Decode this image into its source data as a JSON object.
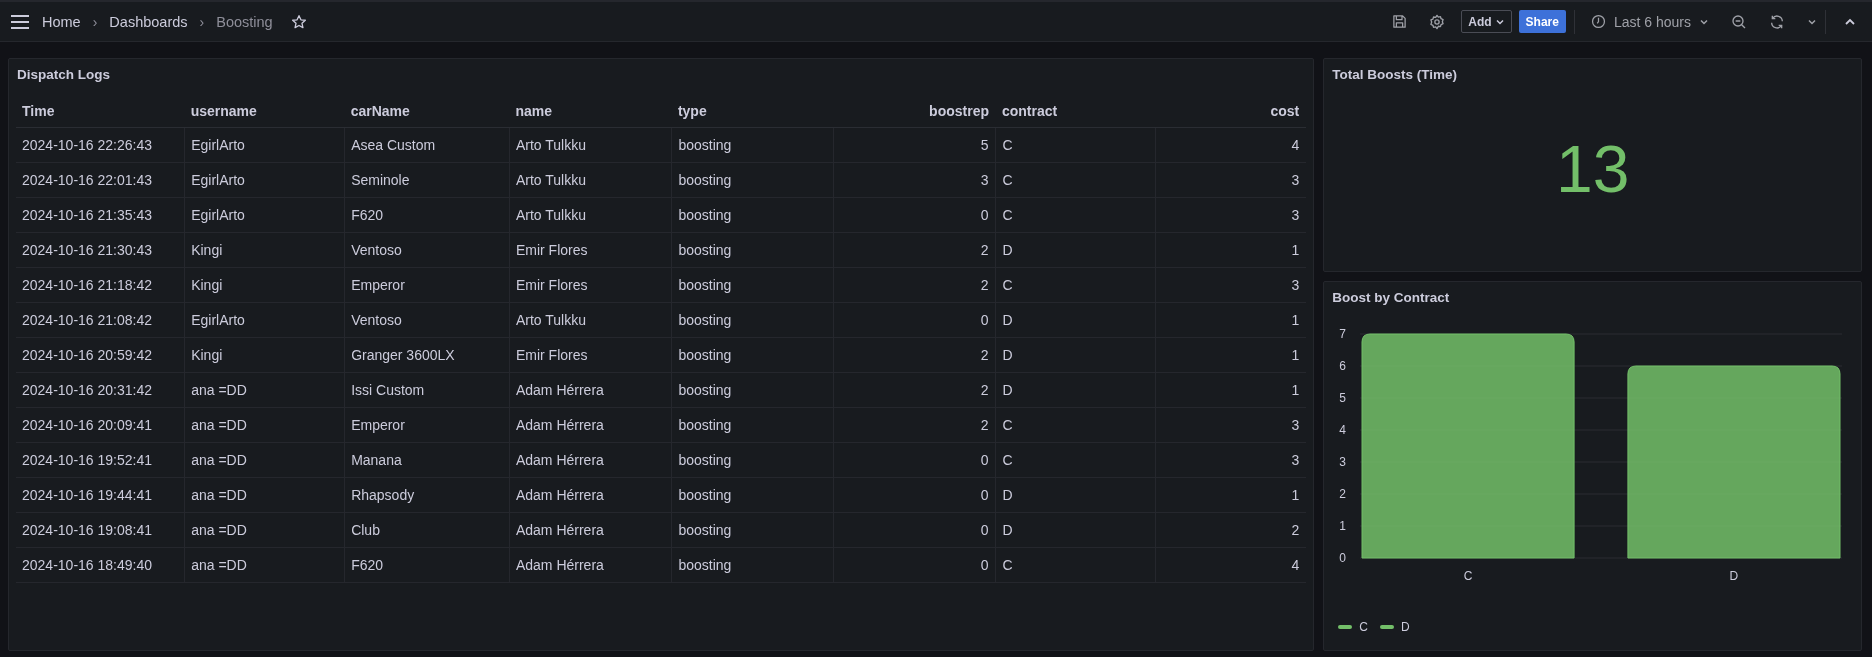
{
  "breadcrumbs": [
    {
      "label": "Home",
      "current": false
    },
    {
      "separator": "›",
      "label": "Dashboards",
      "current": false
    },
    {
      "separator": "›",
      "label": "Boosting",
      "current": true
    }
  ],
  "toolbar": {
    "add_label": "Add",
    "share_label": "Share",
    "time_range": "Last 6 hours"
  },
  "table_panel": {
    "title": "Dispatch Logs",
    "columns": [
      "Time",
      "username",
      "carName",
      "name",
      "type",
      "boostrep",
      "contract",
      "cost"
    ],
    "rows": [
      [
        "2024-10-16 22:26:43",
        "EgirlArto",
        "Asea Custom",
        "Arto Tulkku",
        "boosting",
        "5",
        "C",
        "4"
      ],
      [
        "2024-10-16 22:01:43",
        "EgirlArto",
        "Seminole",
        "Arto Tulkku",
        "boosting",
        "3",
        "C",
        "3"
      ],
      [
        "2024-10-16 21:35:43",
        "EgirlArto",
        "F620",
        "Arto Tulkku",
        "boosting",
        "0",
        "C",
        "3"
      ],
      [
        "2024-10-16 21:30:43",
        "Kingi",
        "Ventoso",
        "Emir Flores",
        "boosting",
        "2",
        "D",
        "1"
      ],
      [
        "2024-10-16 21:18:42",
        "Kingi",
        "Emperor",
        "Emir Flores",
        "boosting",
        "2",
        "C",
        "3"
      ],
      [
        "2024-10-16 21:08:42",
        "EgirlArto",
        "Ventoso",
        "Arto Tulkku",
        "boosting",
        "0",
        "D",
        "1"
      ],
      [
        "2024-10-16 20:59:42",
        "Kingi",
        "Granger 3600LX",
        "Emir Flores",
        "boosting",
        "2",
        "D",
        "1"
      ],
      [
        "2024-10-16 20:31:42",
        "ana =DD",
        "Issi Custom",
        "Adam Hérrera",
        "boosting",
        "2",
        "D",
        "1"
      ],
      [
        "2024-10-16 20:09:41",
        "ana =DD",
        "Emperor",
        "Adam Hérrera",
        "boosting",
        "2",
        "C",
        "3"
      ],
      [
        "2024-10-16 19:52:41",
        "ana =DD",
        "Manana",
        "Adam Hérrera",
        "boosting",
        "0",
        "C",
        "3"
      ],
      [
        "2024-10-16 19:44:41",
        "ana =DD",
        "Rhapsody",
        "Adam Hérrera",
        "boosting",
        "0",
        "D",
        "1"
      ],
      [
        "2024-10-16 19:08:41",
        "ana =DD",
        "Club",
        "Adam Hérrera",
        "boosting",
        "0",
        "D",
        "2"
      ],
      [
        "2024-10-16 18:49:40",
        "ana =DD",
        "F620",
        "Adam Hérrera",
        "boosting",
        "0",
        "C",
        "4"
      ]
    ]
  },
  "stat_panel": {
    "title": "Total Boosts (Time)",
    "value": "13",
    "color": "#73bf69"
  },
  "chart_panel": {
    "title": "Boost by Contract",
    "chart_data": {
      "type": "bar",
      "categories": [
        "C",
        "D"
      ],
      "stacked": true,
      "grid": true,
      "ylim": [
        0,
        7
      ],
      "yticks": [
        0,
        1,
        2,
        3,
        4,
        5,
        6,
        7
      ],
      "series": [
        {
          "name": "C",
          "color": "#73bf69",
          "values": [
            7,
            null
          ]
        },
        {
          "name": "D",
          "color": "#73bf69",
          "values": [
            null,
            6
          ]
        }
      ]
    }
  }
}
